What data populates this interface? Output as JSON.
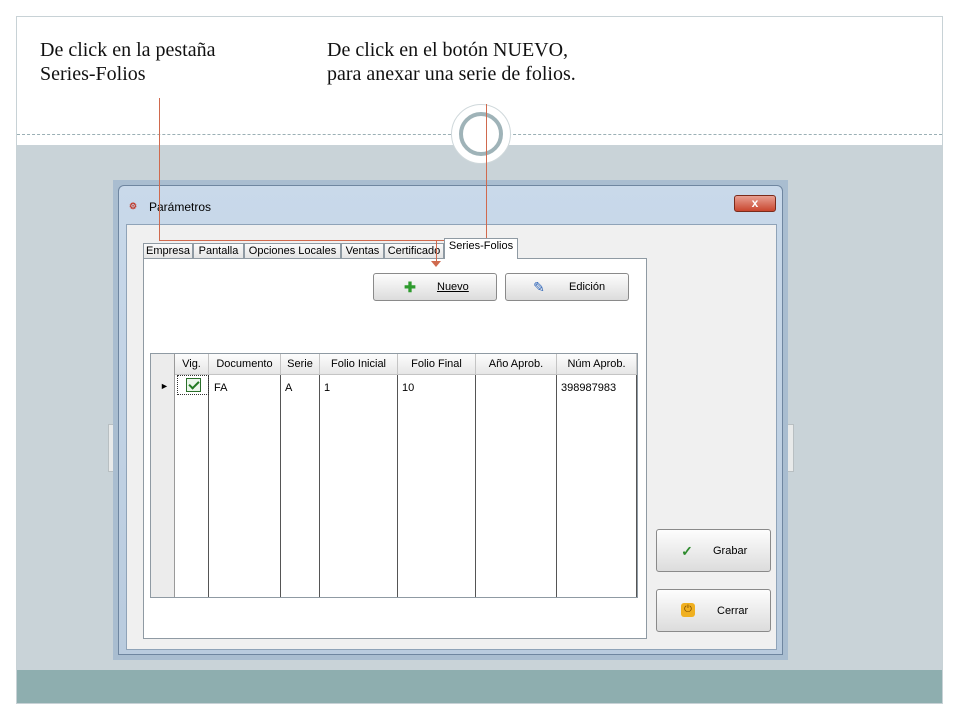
{
  "annotations": {
    "left_line1": "De click en la pestaña",
    "left_line2": "Series-Folios",
    "right_line1": "De click en el botón NUEVO,",
    "right_line2": "para anexar una serie de folios."
  },
  "colors": {
    "accent": "#d06a4e",
    "content_bg": "#c9d3d8",
    "footer_bar": "#8eaeaf"
  },
  "window": {
    "title": "Parámetros",
    "app_icon": "sci-app-icon",
    "close_label": "x"
  },
  "tabs": [
    {
      "label": "Empresa",
      "active": false
    },
    {
      "label": "Pantalla",
      "active": false
    },
    {
      "label": "Opciones Locales",
      "active": false
    },
    {
      "label": "Ventas",
      "active": false
    },
    {
      "label": "Certificado",
      "active": false
    },
    {
      "label": "Series-Folios",
      "active": true
    }
  ],
  "buttons": {
    "nuevo": {
      "label": "Nuevo",
      "icon": "plus-icon"
    },
    "edicion": {
      "label": "Edición",
      "icon": "pencil-icon"
    },
    "grabar": {
      "label": "Grabar",
      "icon": "checkmark-icon"
    },
    "cerrar": {
      "label": "Cerrar",
      "icon": "power-icon"
    }
  },
  "grid": {
    "columns": [
      "Vig.",
      "Documento",
      "Serie",
      "Folio Inicial",
      "Folio Final",
      "Año Aprob.",
      "Núm Aprob."
    ],
    "rows": [
      {
        "vig": true,
        "documento": "FA",
        "serie": "A",
        "folio_inicial": "1",
        "folio_final": "10",
        "anio_aprob": "",
        "num_aprob": "398987983"
      }
    ]
  }
}
